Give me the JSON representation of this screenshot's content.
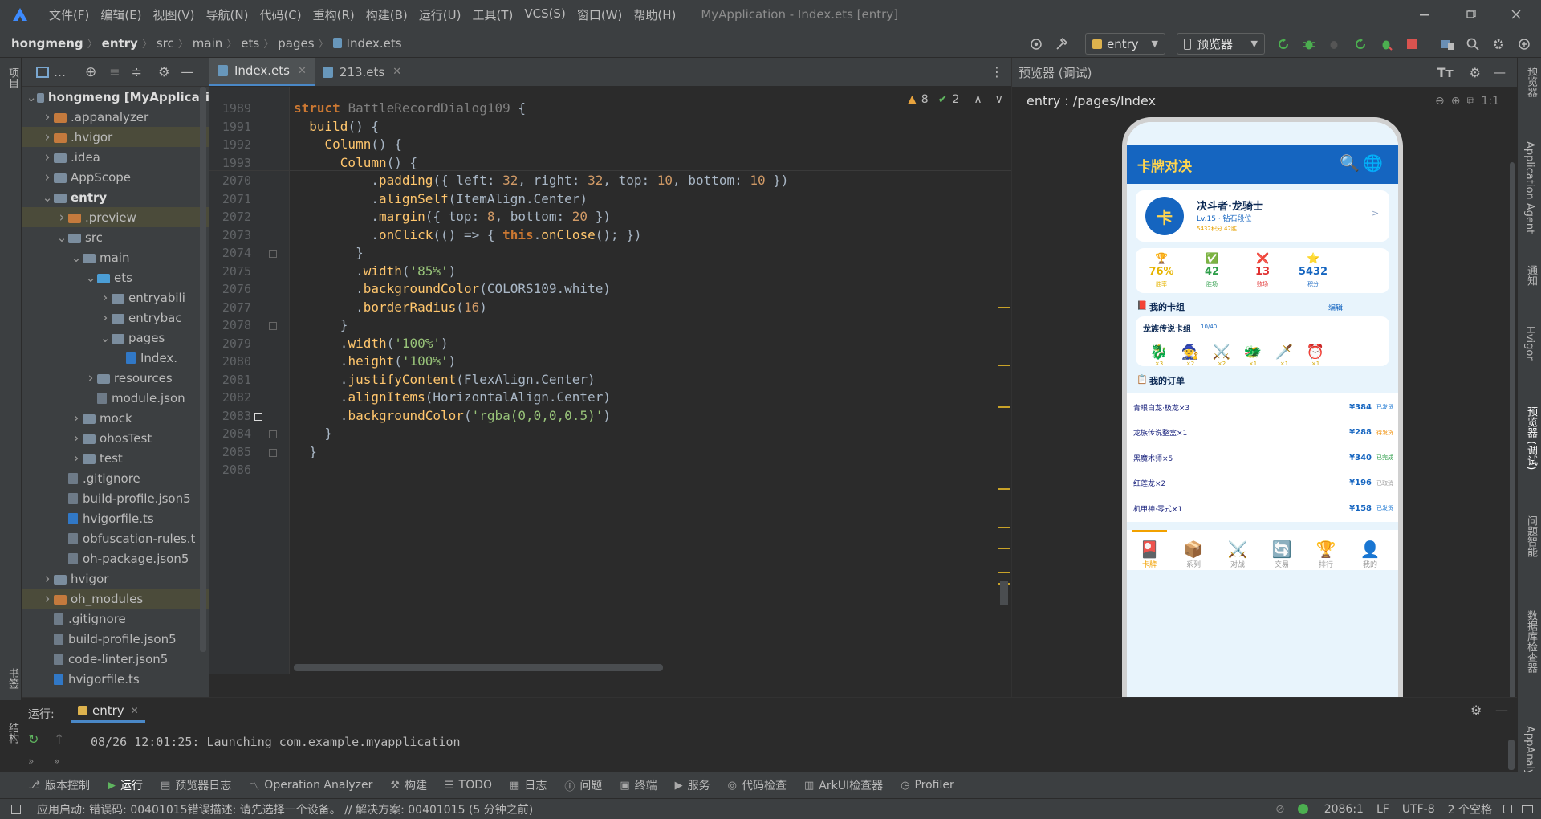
{
  "menubar": {
    "items": [
      "文件(F)",
      "编辑(E)",
      "视图(V)",
      "导航(N)",
      "代码(C)",
      "重构(R)",
      "构建(B)",
      "运行(U)",
      "工具(T)",
      "VCS(S)",
      "窗口(W)",
      "帮助(H)"
    ],
    "title": "MyApplication - Index.ets [entry]"
  },
  "breadcrumb": [
    "hongmeng",
    "entry",
    "src",
    "main",
    "ets",
    "pages",
    "Index.ets"
  ],
  "toolbar": {
    "run_config": "entry",
    "device": "预览器"
  },
  "project_tree": [
    {
      "label": "hongmeng [MyApplicati",
      "indent": 0,
      "kind": "folder",
      "open": true
    },
    {
      "label": ".appanalyzer",
      "indent": 1,
      "kind": "folder-orange",
      "open": false
    },
    {
      "label": ".hvigor",
      "indent": 1,
      "kind": "folder-orange",
      "open": false
    },
    {
      "label": ".idea",
      "indent": 1,
      "kind": "folder",
      "open": false
    },
    {
      "label": "AppScope",
      "indent": 1,
      "kind": "folder",
      "open": false
    },
    {
      "label": "entry",
      "indent": 1,
      "kind": "folder",
      "open": true
    },
    {
      "label": ".preview",
      "indent": 2,
      "kind": "folder-orange",
      "open": false
    },
    {
      "label": "src",
      "indent": 2,
      "kind": "folder",
      "open": true
    },
    {
      "label": "main",
      "indent": 3,
      "kind": "folder",
      "open": true
    },
    {
      "label": "ets",
      "indent": 4,
      "kind": "folder-blue",
      "open": true
    },
    {
      "label": "entryabili",
      "indent": 5,
      "kind": "folder",
      "open": false
    },
    {
      "label": "entrybac",
      "indent": 5,
      "kind": "folder",
      "open": false
    },
    {
      "label": "pages",
      "indent": 5,
      "kind": "folder",
      "open": true
    },
    {
      "label": "Index.",
      "indent": 6,
      "kind": "file-ts"
    },
    {
      "label": "resources",
      "indent": 4,
      "kind": "folder",
      "open": false
    },
    {
      "label": "module.json",
      "indent": 4,
      "kind": "file"
    },
    {
      "label": "mock",
      "indent": 3,
      "kind": "folder",
      "open": false
    },
    {
      "label": "ohosTest",
      "indent": 3,
      "kind": "folder",
      "open": false
    },
    {
      "label": "test",
      "indent": 3,
      "kind": "folder",
      "open": false
    },
    {
      "label": ".gitignore",
      "indent": 2,
      "kind": "file"
    },
    {
      "label": "build-profile.json5",
      "indent": 2,
      "kind": "file"
    },
    {
      "label": "hvigorfile.ts",
      "indent": 2,
      "kind": "file-ts"
    },
    {
      "label": "obfuscation-rules.t",
      "indent": 2,
      "kind": "file"
    },
    {
      "label": "oh-package.json5",
      "indent": 2,
      "kind": "file"
    },
    {
      "label": "hvigor",
      "indent": 1,
      "kind": "folder",
      "open": false
    },
    {
      "label": "oh_modules",
      "indent": 1,
      "kind": "folder-orange",
      "open": false
    },
    {
      "label": ".gitignore",
      "indent": 1,
      "kind": "file"
    },
    {
      "label": "build-profile.json5",
      "indent": 1,
      "kind": "file"
    },
    {
      "label": "code-linter.json5",
      "indent": 1,
      "kind": "file"
    },
    {
      "label": "hvigorfile.ts",
      "indent": 1,
      "kind": "file-ts"
    }
  ],
  "editor": {
    "tabs": [
      "Index.ets",
      "213.ets"
    ],
    "warnings": "8",
    "weak_warnings": "2",
    "sticky_lines": [
      {
        "num": "1989",
        "code": "struct BattleRecordDialog109 {"
      },
      {
        "num": "1991",
        "code": "  build() {"
      },
      {
        "num": "1992",
        "code": "    Column() {"
      },
      {
        "num": "1993",
        "code": "      Column() {"
      }
    ],
    "lines": [
      {
        "num": "2070",
        "code": "          .padding({ left: 32, right: 32, top: 10, bottom: 10 })"
      },
      {
        "num": "2071",
        "code": "          .alignSelf(ItemAlign.Center)"
      },
      {
        "num": "2072",
        "code": "          .margin({ top: 8, bottom: 20 })"
      },
      {
        "num": "2073",
        "code": "          .onClick(() => { this.onClose(); })"
      },
      {
        "num": "2074",
        "code": "        }"
      },
      {
        "num": "2075",
        "code": "        .width('85%')"
      },
      {
        "num": "2076",
        "code": "        .backgroundColor(COLORS109.white)"
      },
      {
        "num": "2077",
        "code": "        .borderRadius(16)"
      },
      {
        "num": "2078",
        "code": "      }"
      },
      {
        "num": "2079",
        "code": "      .width('100%')"
      },
      {
        "num": "2080",
        "code": "      .height('100%')"
      },
      {
        "num": "2081",
        "code": "      .justifyContent(FlexAlign.Center)"
      },
      {
        "num": "2082",
        "code": "      .alignItems(HorizontalAlign.Center)"
      },
      {
        "num": "2083",
        "code": "      .backgroundColor('rgba(0,0,0,0.5)')"
      },
      {
        "num": "2084",
        "code": "    }"
      },
      {
        "num": "2085",
        "code": "  }"
      },
      {
        "num": "2086",
        "code": ""
      }
    ]
  },
  "previewer": {
    "title": "预览器 (调试)",
    "path": "entry : /pages/Index",
    "zoom": "1:1",
    "app": {
      "header_title": "卡牌对决",
      "avatar_char": "卡",
      "player_name": "决斗者·龙骑士",
      "player_level": "Lv.15 · 钻石段位",
      "player_stats": "5432积分  42胜",
      "stats": [
        {
          "icon": "🏆",
          "value": "76%",
          "label": "胜率",
          "color": "#e6b400"
        },
        {
          "icon": "✅",
          "value": "42",
          "label": "胜场",
          "color": "#2e9e4a"
        },
        {
          "icon": "❌",
          "value": "13",
          "label": "败场",
          "color": "#e03030"
        },
        {
          "icon": "⭐",
          "value": "5432",
          "label": "积分",
          "color": "#1565c0"
        }
      ],
      "deck_section": "我的卡组",
      "deck_edit": "编辑",
      "deck_name": "龙族传说卡组",
      "deck_count": "10/40",
      "deck_cards": [
        {
          "icon": "🐉",
          "qty": "×3"
        },
        {
          "icon": "🧙",
          "qty": "×2"
        },
        {
          "icon": "⚔️",
          "qty": "×2"
        },
        {
          "icon": "🐲",
          "qty": "×1"
        },
        {
          "icon": "🗡️",
          "qty": "×1"
        },
        {
          "icon": "⏰",
          "qty": "×1"
        }
      ],
      "orders_section": "我的订单",
      "orders": [
        {
          "name": "青眼白龙·极龙×3",
          "price": "¥384",
          "status": "已发货",
          "status_color": "#1976d2"
        },
        {
          "name": "龙族传说整盒×1",
          "price": "¥288",
          "status": "待发货",
          "status_color": "#f08c00"
        },
        {
          "name": "黑魔术师×5",
          "price": "¥340",
          "status": "已完成",
          "status_color": "#2e9e4a"
        },
        {
          "name": "红莲龙×2",
          "price": "¥196",
          "status": "已取消",
          "status_color": "#999999"
        },
        {
          "name": "机甲神·零式×1",
          "price": "¥158",
          "status": "已发货",
          "status_color": "#1976d2"
        }
      ],
      "nav": [
        {
          "icon": "🎴",
          "label": "卡牌"
        },
        {
          "icon": "📦",
          "label": "系列"
        },
        {
          "icon": "⚔️",
          "label": "对战"
        },
        {
          "icon": "🔄",
          "label": "交易"
        },
        {
          "icon": "🏆",
          "label": "排行"
        },
        {
          "icon": "👤",
          "label": "我的"
        }
      ]
    }
  },
  "run_panel": {
    "label": "运行:",
    "tab": "entry",
    "log": "08/26 12:01:25: Launching com.example.myapplication"
  },
  "tool_windows": [
    "版本控制",
    "运行",
    "预览器日志",
    "Operation Analyzer",
    "构建",
    "TODO",
    "日志",
    "问题",
    "终端",
    "服务",
    "代码检查",
    "ArkUI检查器",
    "Profiler"
  ],
  "status_bar": {
    "message": "应用启动: 错误码: 00401015错误描述: 请先选择一个设备。 // 解决方案: 00401015 (5 分钟之前)",
    "position": "2086:1",
    "line_sep": "LF",
    "encoding": "UTF-8",
    "indent": "2 个空格"
  },
  "side_labels": {
    "left_top": "项目",
    "left_bottom1": "书签",
    "left_bottom2": "结构",
    "right": [
      "预览器",
      "Application Agent",
      "通知",
      "Hvigor",
      "预览器 (调试)",
      "问题智能",
      "数据库检查器",
      "AppAnaly"
    ]
  },
  "colors": {
    "accent": "#4a88c7",
    "app_header": "#1565c0",
    "app_bg": "#e3f2fd"
  }
}
